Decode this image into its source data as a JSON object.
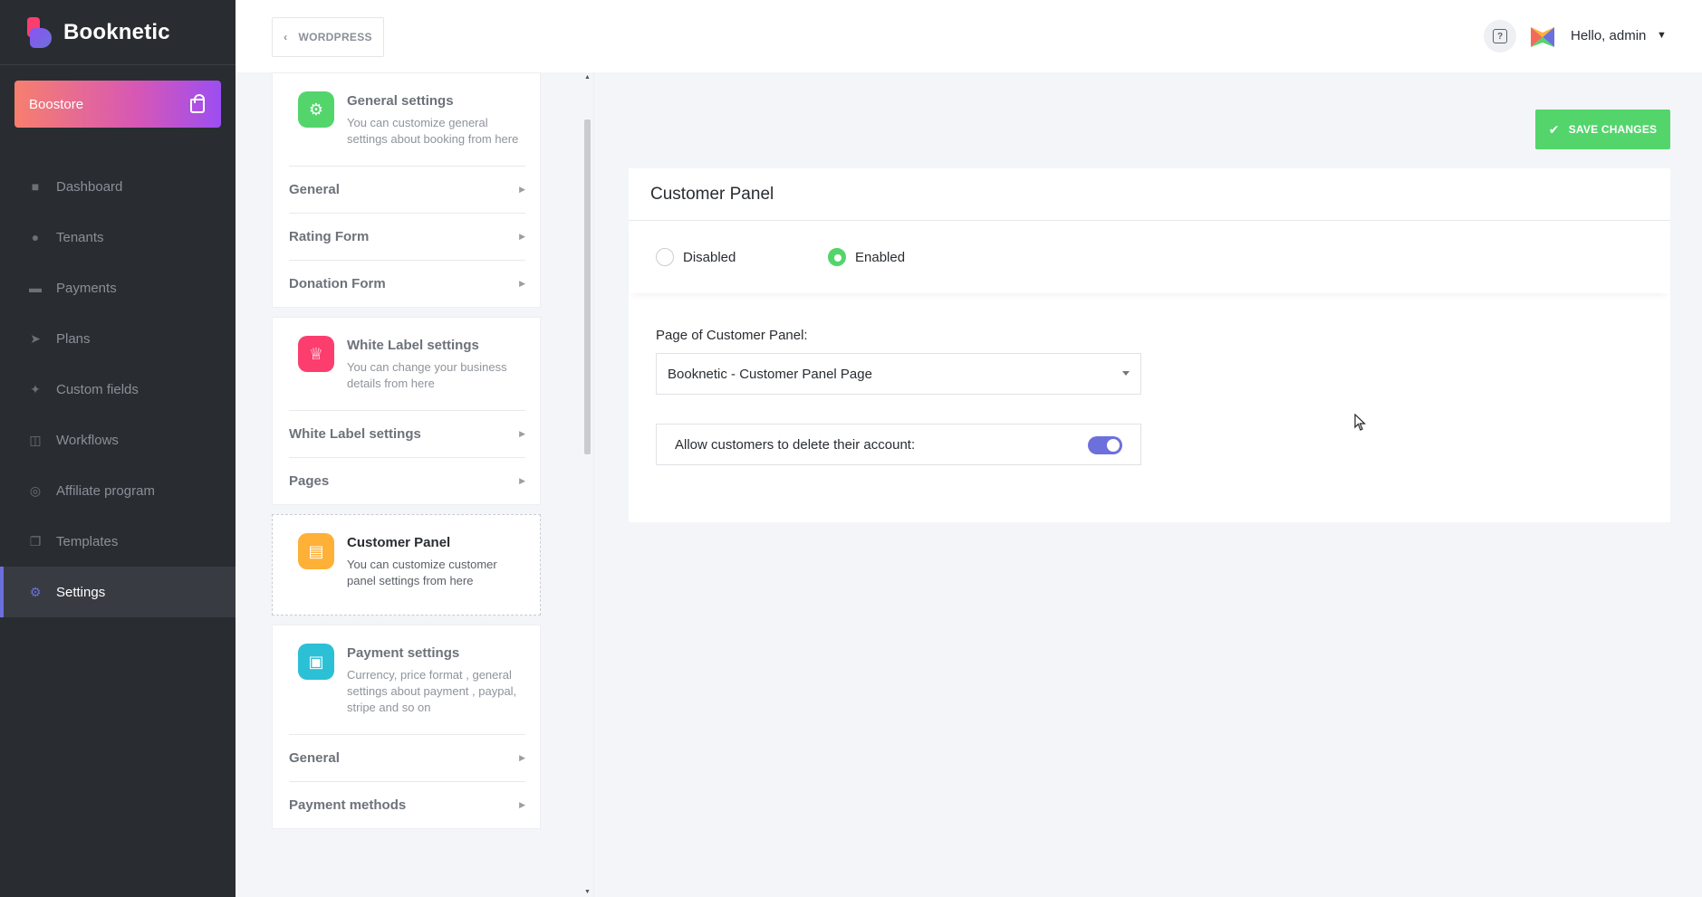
{
  "brand": {
    "name": "Booknetic"
  },
  "boostore": {
    "label": "Boostore",
    "icon": "shopping-bag-icon"
  },
  "sidebar": {
    "items": [
      {
        "label": "Dashboard",
        "icon": "cube-icon",
        "active": false
      },
      {
        "label": "Tenants",
        "icon": "user-icon",
        "active": false
      },
      {
        "label": "Payments",
        "icon": "credit-card-icon",
        "active": false
      },
      {
        "label": "Plans",
        "icon": "rocket-icon",
        "active": false
      },
      {
        "label": "Custom fields",
        "icon": "magic-wand-icon",
        "active": false
      },
      {
        "label": "Workflows",
        "icon": "workflow-icon",
        "active": false
      },
      {
        "label": "Affiliate program",
        "icon": "target-icon",
        "active": false
      },
      {
        "label": "Templates",
        "icon": "copy-icon",
        "active": false
      },
      {
        "label": "Settings",
        "icon": "gear-icon",
        "active": true
      }
    ]
  },
  "topbar": {
    "wordpress_label": "WORDPRESS",
    "user_greeting": "Hello, admin"
  },
  "settings_cards": [
    {
      "title": "General settings",
      "description": "You can customize general settings about booking from here",
      "icon": "gear-icon",
      "color": "#53d56c",
      "items": [
        "General",
        "Rating Form",
        "Donation Form"
      ]
    },
    {
      "title": "White Label settings",
      "description": "You can change your business details from here",
      "icon": "crown-icon",
      "color": "#fb3e6e",
      "items": [
        "White Label settings",
        "Pages"
      ]
    },
    {
      "title": "Customer Panel",
      "description": "You can customize customer panel settings from here",
      "icon": "calendar-clock-icon",
      "color": "#ffb037",
      "active": true,
      "items": []
    },
    {
      "title": "Payment settings",
      "description": "Currency, price format , general settings about payment , paypal, stripe and so on",
      "icon": "wallet-icon",
      "color": "#2cc0d6",
      "items": [
        "General",
        "Payment methods"
      ]
    }
  ],
  "main": {
    "save_label": "SAVE CHANGES",
    "panel_title": "Customer Panel",
    "radio_disabled": "Disabled",
    "radio_enabled": "Enabled",
    "selected_mode": "Enabled",
    "page_label": "Page of Customer Panel:",
    "page_value": "Booknetic - Customer Panel Page",
    "delete_account_label": "Allow customers to delete their account:",
    "delete_account_enabled": true
  },
  "colors": {
    "accent": "#6c70dc",
    "success": "#53d56c",
    "sidebar_bg": "#292d32"
  }
}
